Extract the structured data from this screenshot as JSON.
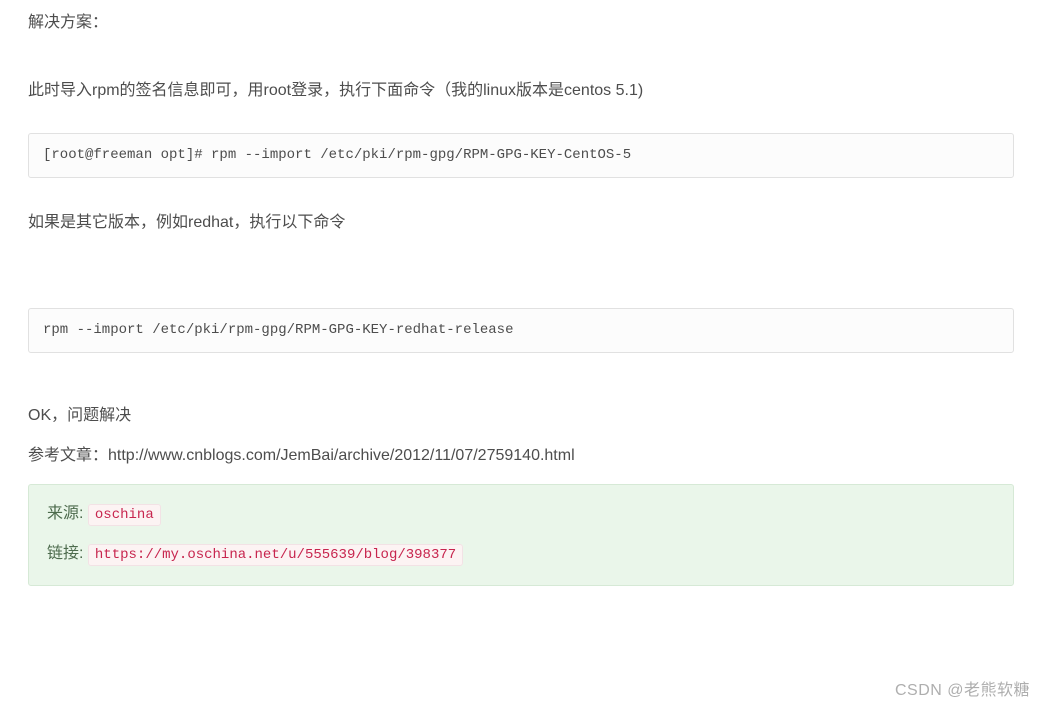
{
  "p1": "解决方案：",
  "p2": "此时导入rpm的签名信息即可，用root登录，执行下面命令（我的linux版本是centos 5.1)",
  "code1": "[root@freeman opt]# rpm --import /etc/pki/rpm-gpg/RPM-GPG-KEY-CentOS-5",
  "p3": "如果是其它版本，例如redhat，执行以下命令",
  "code2": "rpm --import /etc/pki/rpm-gpg/RPM-GPG-KEY-redhat-release",
  "p4": "OK，问题解决",
  "p5": "参考文章：http://www.cnblogs.com/JemBai/archive/2012/11/07/2759140.html",
  "source": {
    "label1": "来源: ",
    "value1": "oschina",
    "label2": "链接: ",
    "value2": "https://my.oschina.net/u/555639/blog/398377"
  },
  "watermark": "CSDN @老熊软糖"
}
